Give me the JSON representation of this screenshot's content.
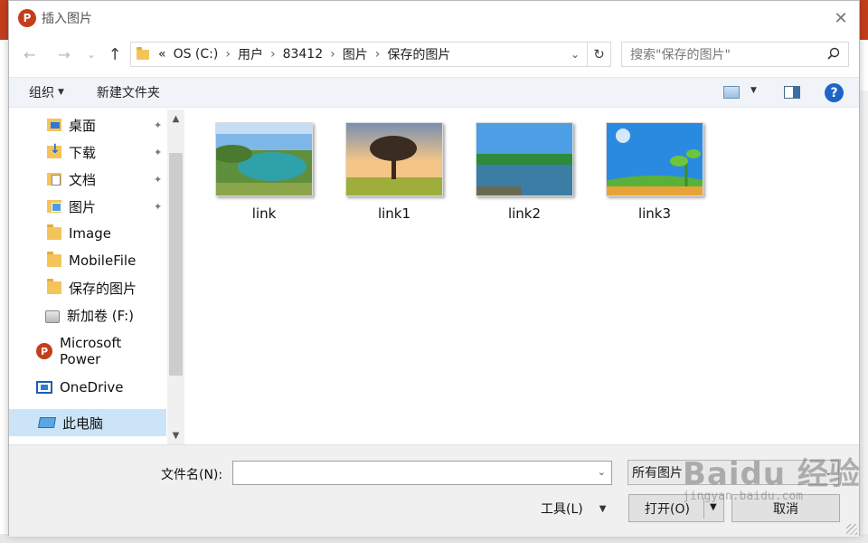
{
  "dialog": {
    "title": "插入图片",
    "app_icon_letter": "P",
    "close_glyph": "✕"
  },
  "nav": {
    "back": "←",
    "forward": "→",
    "recent": "⌄",
    "up": "↑"
  },
  "address": {
    "crumbs": [
      "«",
      "OS (C:)",
      "用户",
      "83412",
      "图片",
      "保存的图片"
    ],
    "separator": "›",
    "dropdown": "⌄",
    "refresh": "↻"
  },
  "search": {
    "placeholder": "搜索\"保存的图片\""
  },
  "toolbar": {
    "organize": "组织",
    "new_folder": "新建文件夹",
    "help": "?"
  },
  "sidebar": {
    "items": [
      {
        "label": "桌面",
        "icon": "desktop-folder-icon",
        "pinned": true
      },
      {
        "label": "下载",
        "icon": "download-folder-icon",
        "pinned": true
      },
      {
        "label": "文档",
        "icon": "documents-folder-icon",
        "pinned": true
      },
      {
        "label": "图片",
        "icon": "pictures-folder-icon",
        "pinned": true
      },
      {
        "label": "Image",
        "icon": "folder-icon"
      },
      {
        "label": "MobileFile",
        "icon": "folder-icon"
      },
      {
        "label": "保存的图片",
        "icon": "folder-icon"
      },
      {
        "label": "新加卷 (F:)",
        "icon": "drive-icon"
      },
      {
        "label": "Microsoft Power",
        "icon": "powerpoint-icon"
      },
      {
        "label": "OneDrive",
        "icon": "onedrive-icon"
      },
      {
        "label": "此电脑",
        "icon": "pc-icon",
        "selected": true
      }
    ],
    "pin_glyph": "📌"
  },
  "files": [
    {
      "name": "link",
      "thumbnail": "lake-landscape"
    },
    {
      "name": "link1",
      "thumbnail": "tree-sunset"
    },
    {
      "name": "link2",
      "thumbnail": "river-park"
    },
    {
      "name": "link3",
      "thumbnail": "sky-sprout"
    }
  ],
  "bottom": {
    "filename_label": "文件名(N):",
    "filename_value": "",
    "filter_value": "所有图片",
    "tools_label": "工具(L)",
    "open_label": "打开(O)",
    "cancel_label": "取消"
  },
  "watermark": {
    "logo": "Baidu 经验",
    "sub": "jingyan.baidu.com"
  },
  "colors": {
    "accent": "#1e63c8",
    "ppt": "#c43e1c",
    "selected_bg": "#cce4f7",
    "folder": "#f4c45a"
  }
}
